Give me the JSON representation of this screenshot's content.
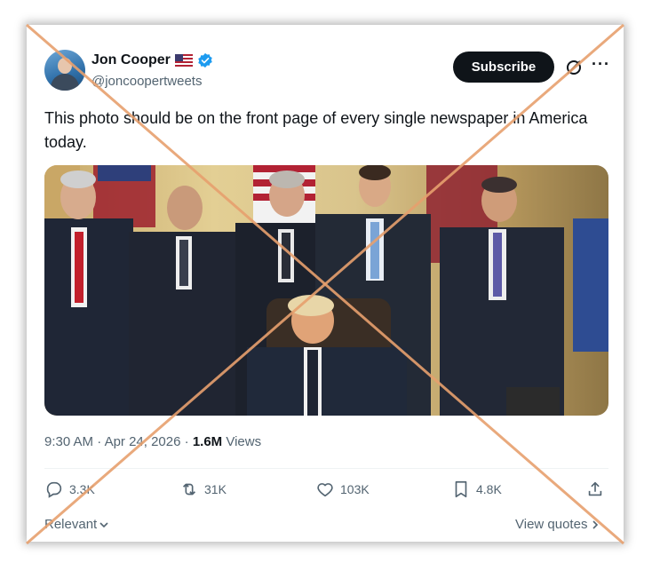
{
  "tweet": {
    "author_name": "Jon Cooper",
    "handle": "@joncoopertweets",
    "subscribe_label": "Subscribe",
    "more_label": "···",
    "text": "This photo should be on the front page of every single newspaper in America today.",
    "time": "9:30 AM",
    "date": "Apr 24, 2026",
    "views_count": "1.6M",
    "views_label": "Views",
    "dot": "·"
  },
  "actions": {
    "replies": "3.3K",
    "reposts": "31K",
    "likes": "103K",
    "bookmarks": "4.8K"
  },
  "footer": {
    "relevant_label": "Relevant",
    "view_quotes_label": "View quotes"
  },
  "icons": {
    "flag": "us-flag-icon",
    "verified": "verified-badge-icon",
    "grok": "grok-icon",
    "reply": "reply-icon",
    "repost": "repost-icon",
    "like": "like-icon",
    "bookmark": "bookmark-icon",
    "share": "share-icon"
  },
  "colors": {
    "verified_blue": "#1d9bf0",
    "text_primary": "#0f1419",
    "text_secondary": "#536471",
    "cross_orange": "#e7a06e"
  }
}
